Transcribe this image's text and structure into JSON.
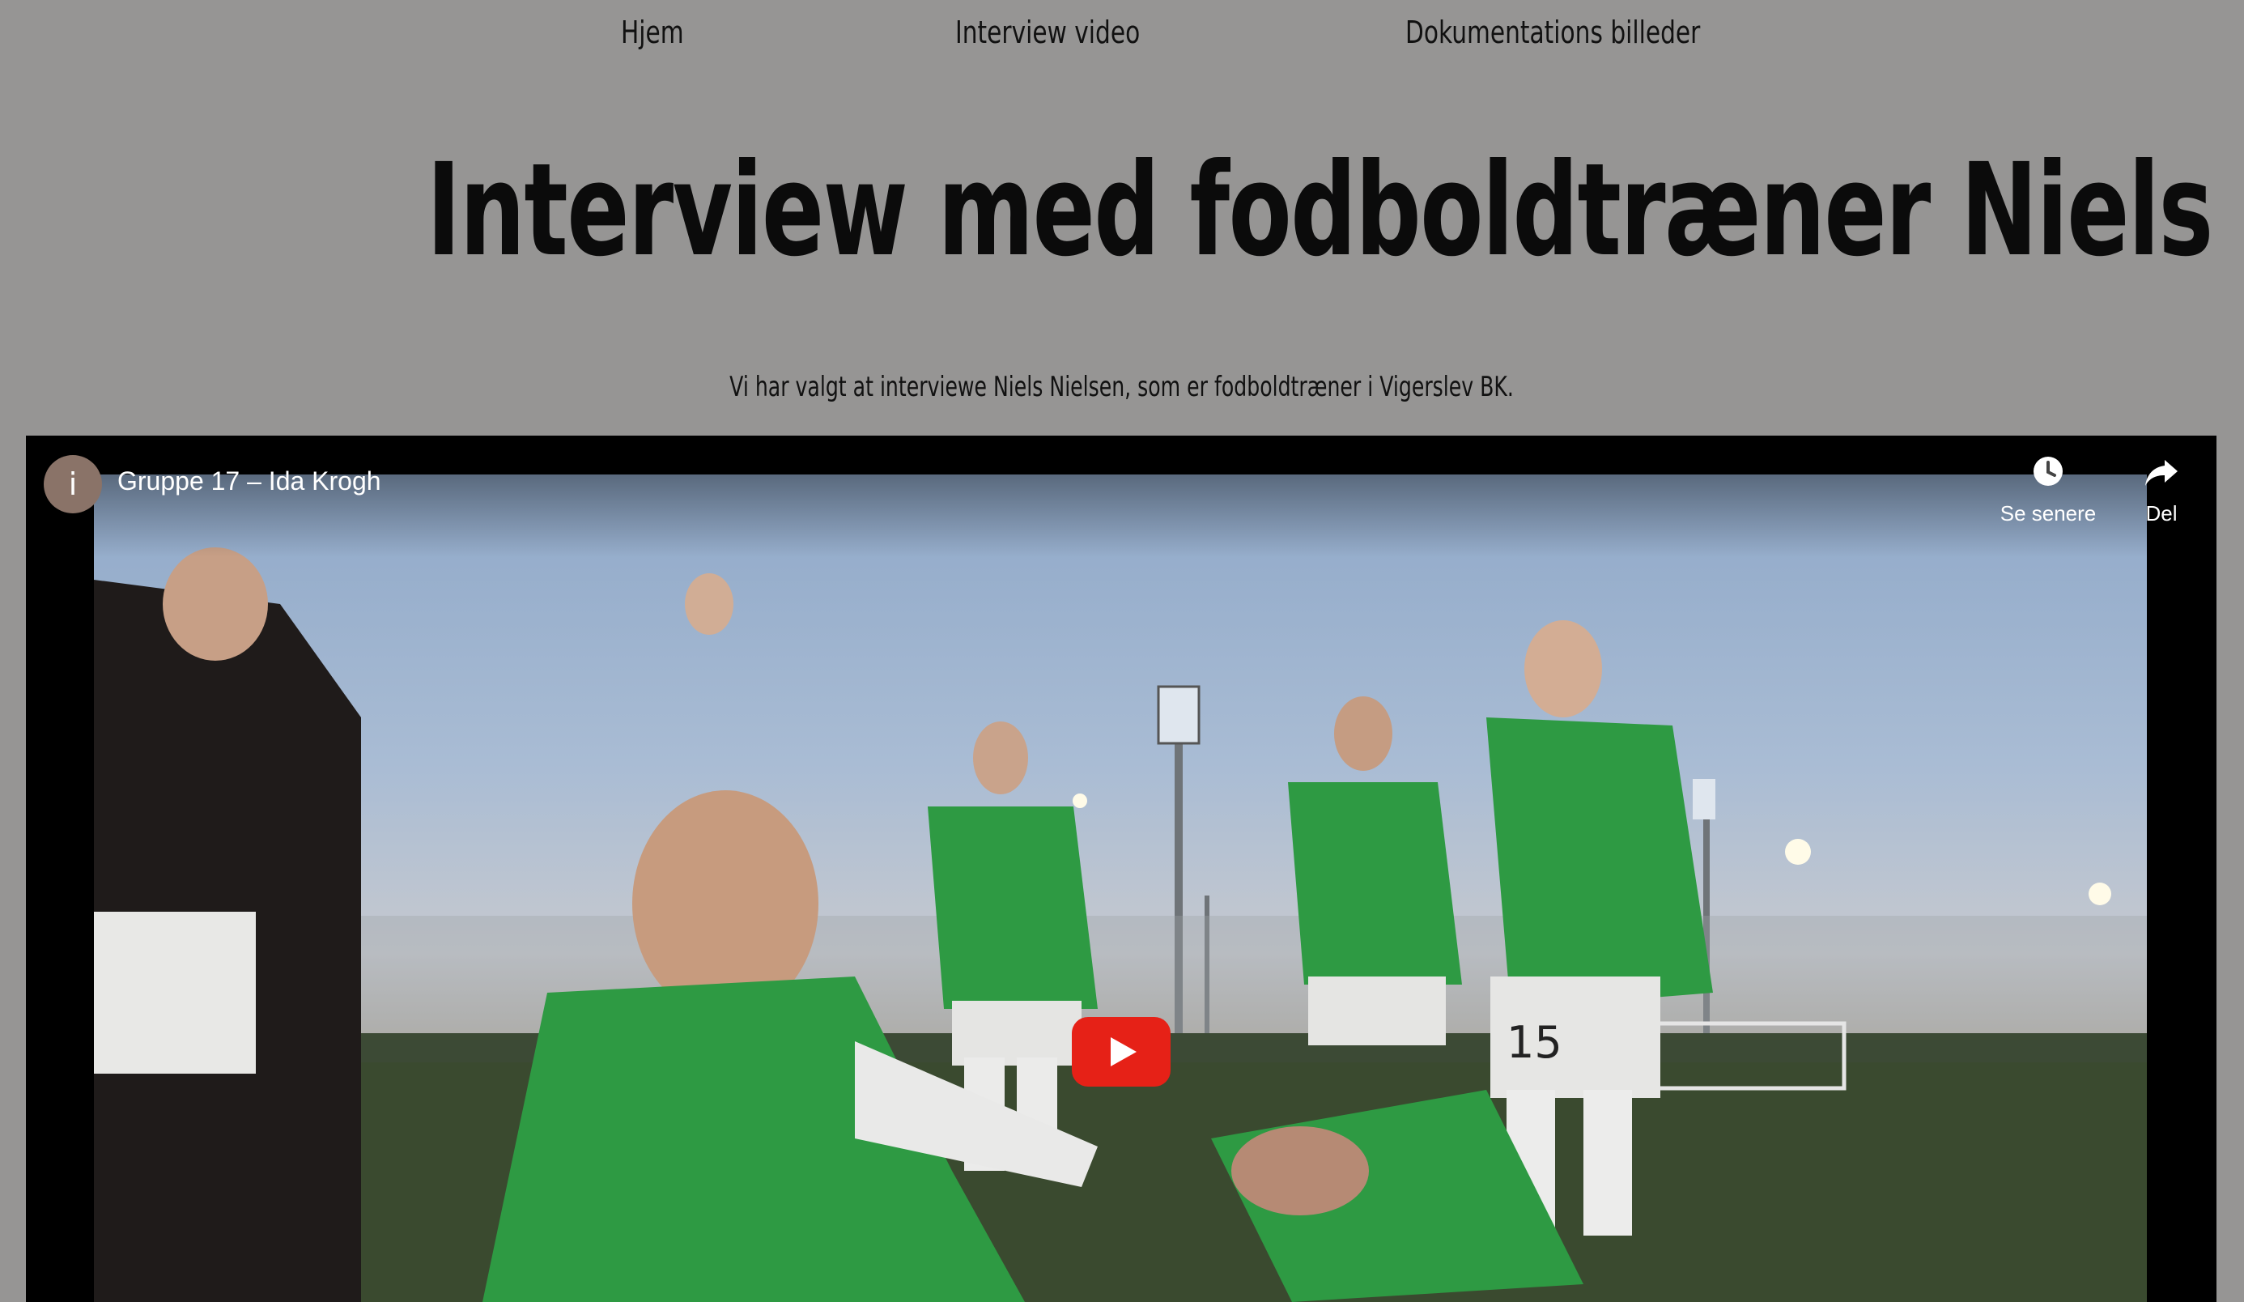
{
  "nav": {
    "items": [
      {
        "label": "Hjem"
      },
      {
        "label": "Interview video"
      },
      {
        "label": "Dokumentations billeder"
      }
    ]
  },
  "page": {
    "title": "Interview med fodboldtræner Niels Nielsen",
    "intro": "Vi har valgt at interviewe Niels Nielsen, som er fodboldtræner i Vigerslev BK."
  },
  "video": {
    "channel_initial": "i",
    "title": "Gruppe 17 – Ida Krogh",
    "watch_later_label": "Se senere",
    "share_label": "Del",
    "jersey_number": "15",
    "colors": {
      "player_bar": "#000000",
      "play_button": "#e62117",
      "avatar": "#8a7368",
      "jersey_green": "#2e9a43"
    },
    "icons": {
      "watch_later": "clock-icon",
      "share": "share-arrow-icon",
      "play": "play-icon"
    }
  }
}
